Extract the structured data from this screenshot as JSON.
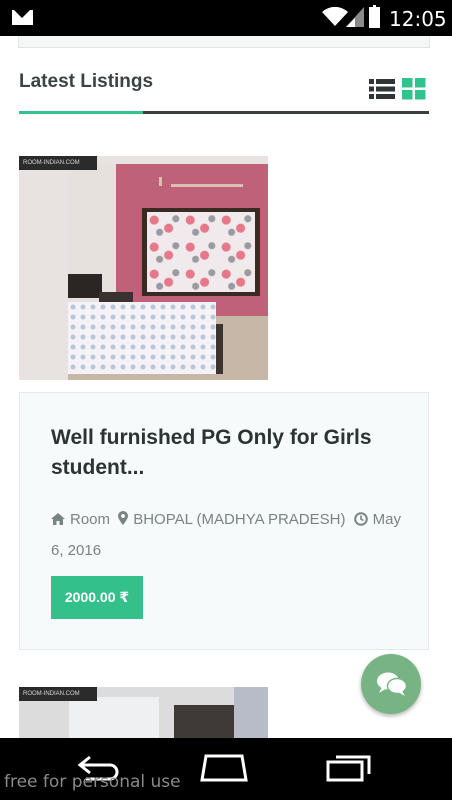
{
  "status_bar": {
    "time": "12:05",
    "icons": [
      "mail-icon",
      "wifi-icon",
      "signal-icon",
      "battery-icon"
    ]
  },
  "listings": {
    "section_title": "Latest Listings",
    "view_toggle": {
      "list_icon": "list-view-icon",
      "grid_icon": "grid-view-icon",
      "active": "grid",
      "active_color": "#32c28c"
    },
    "items": [
      {
        "watermark": "ROOM-INDIAN.COM",
        "title": "Well furnished PG Only for Girls student...",
        "category": "Room",
        "location": "BHOPAL (MADHYA PRADESH)",
        "date": "May 6, 2016",
        "price": "2000.00 ₹",
        "category_icon": "home-icon",
        "location_icon": "map-marker-icon",
        "date_icon": "clock-icon"
      },
      {
        "watermark": "ROOM-INDIAN.COM"
      }
    ]
  },
  "chat_button": {
    "icon": "chat-icon",
    "color": "#78b483"
  },
  "nav_bar": {
    "icons": [
      "back-icon",
      "home-icon",
      "recents-icon"
    ]
  },
  "footer_note": "free for personal use",
  "colors": {
    "accent": "#32c28c",
    "price_bg": "#33c08a"
  }
}
